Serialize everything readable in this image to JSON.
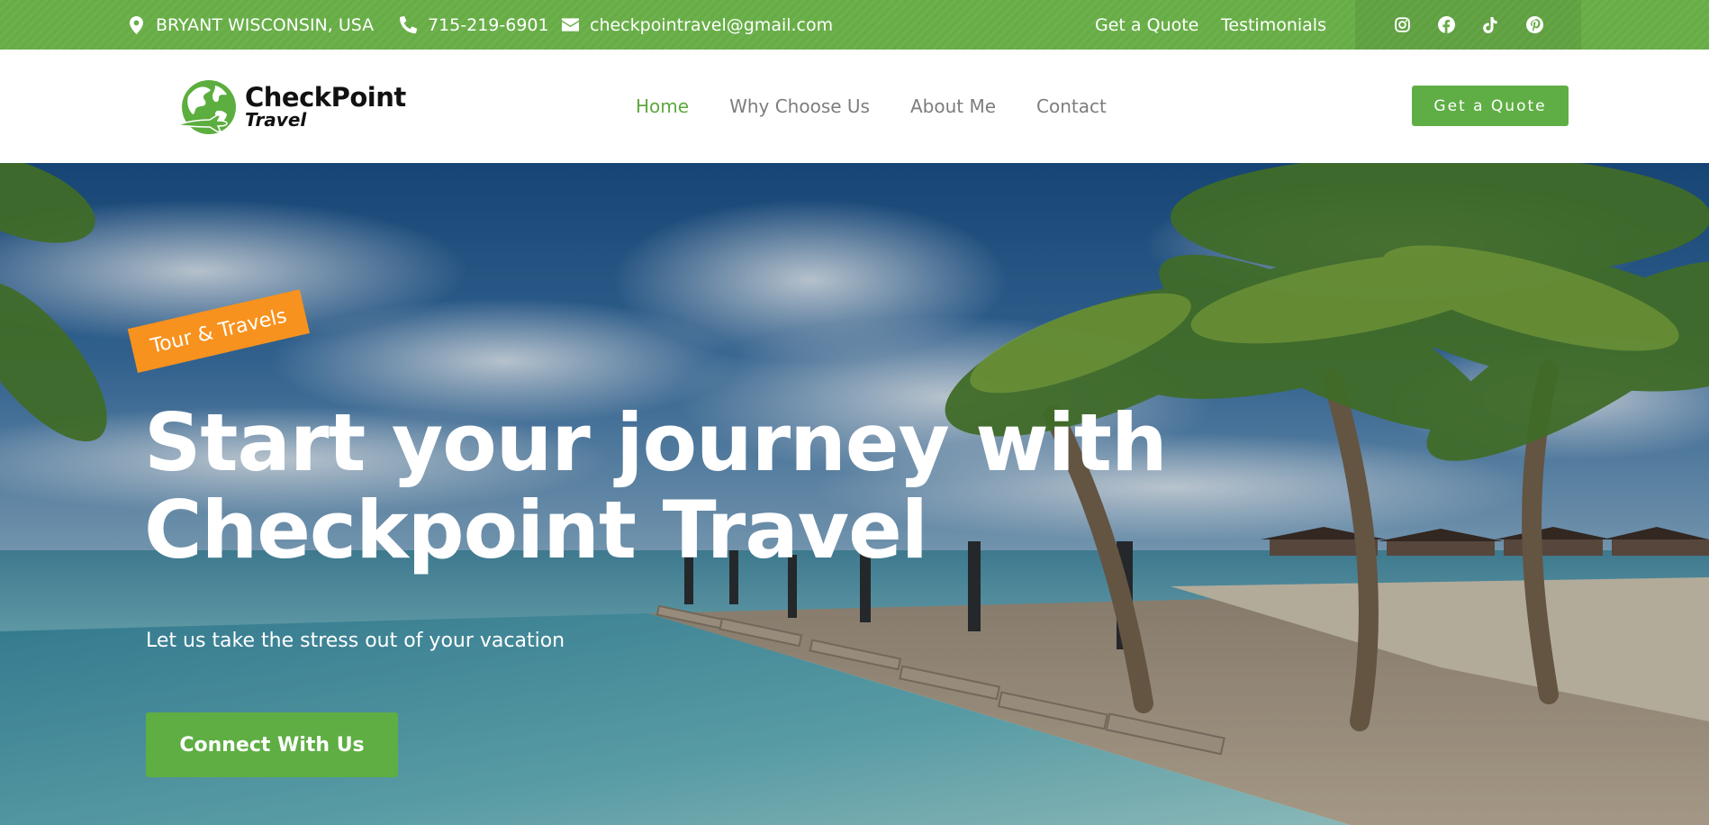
{
  "topbar": {
    "address": "BRYANT WISCONSIN, USA",
    "phone": "715-219-6901",
    "email": "checkpointravel@gmail.com",
    "links": [
      "Get a Quote",
      "Testimonials"
    ],
    "social_icons": [
      "instagram-icon",
      "facebook-icon",
      "tiktok-icon",
      "pinterest-icon"
    ],
    "color": "#67ad46"
  },
  "header": {
    "logo": {
      "line1": "CheckPoint",
      "line2": "Travel"
    },
    "nav": [
      {
        "label": "Home",
        "active": true
      },
      {
        "label": "Why Choose Us",
        "active": false
      },
      {
        "label": "About Me",
        "active": false
      },
      {
        "label": "Contact",
        "active": false
      }
    ],
    "quote_button": "Get a Quote"
  },
  "hero": {
    "badge": "Tour & Travels",
    "title_line1": "Start your journey with",
    "title_line2": "Checkpoint Travel",
    "subtitle": "Let us take the stress out of your vacation",
    "cta": "Connect With Us",
    "badge_color": "#f7921e",
    "accent": "#5eae43"
  }
}
